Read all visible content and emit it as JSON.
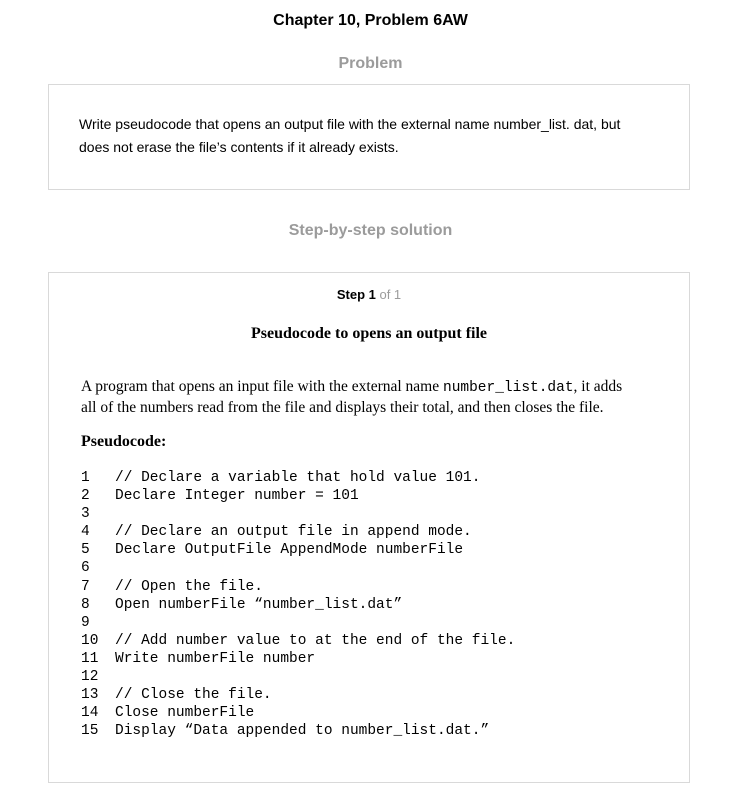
{
  "header": {
    "title": "Chapter 10, Problem 6AW"
  },
  "problem": {
    "heading": "Problem",
    "text_line1": "Write pseudocode that opens an output file with the external name number_list. dat, but",
    "text_line2": "does not erase the file’s contents if it already exists."
  },
  "solution": {
    "heading": "Step-by-step solution",
    "step_word": "Step 1",
    "step_of": " of 1",
    "title": "Pseudocode to opens an output file",
    "intro_before": "A program that opens an input file with the external name ",
    "intro_code": "number_list.dat",
    "intro_after": ", it adds",
    "intro_line2": "all of the numbers read from the file and displays their total, and then closes the file.",
    "pseudocode_label": "Pseudocode:",
    "code_lines": [
      {
        "n": "1",
        "text": "// Declare a variable that hold value 101."
      },
      {
        "n": "2",
        "text": "Declare Integer number = 101"
      },
      {
        "n": "3",
        "text": ""
      },
      {
        "n": "4",
        "text": "// Declare an output file in append mode."
      },
      {
        "n": "5",
        "text": "Declare OutputFile AppendMode numberFile"
      },
      {
        "n": "6",
        "text": ""
      },
      {
        "n": "7",
        "text": "// Open the file."
      },
      {
        "n": "8",
        "text": "Open numberFile “number_list.dat”"
      },
      {
        "n": "9",
        "text": ""
      },
      {
        "n": "10",
        "text": "// Add number value to at the end of the file."
      },
      {
        "n": "11",
        "text": "Write numberFile number"
      },
      {
        "n": "12",
        "text": ""
      },
      {
        "n": "13",
        "text": "// Close the file."
      },
      {
        "n": "14",
        "text": "Close numberFile"
      },
      {
        "n": "15",
        "text": "Display “Data appended to number_list.dat.”"
      }
    ]
  }
}
